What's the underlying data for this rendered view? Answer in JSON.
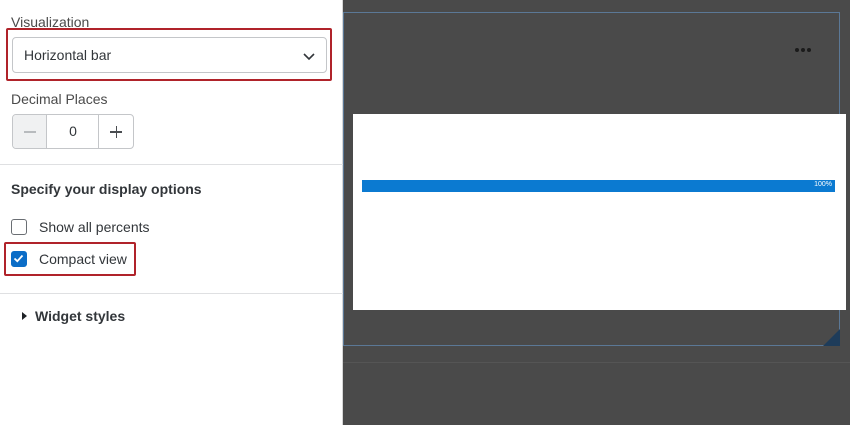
{
  "settings": {
    "visualization_label": "Visualization",
    "visualization_value": "Horizontal bar",
    "decimal_places_label": "Decimal Places",
    "decimal_places_value": "0",
    "display_options_title": "Specify your display options",
    "show_all_percents_label": "Show all percents",
    "show_all_percents_checked": false,
    "compact_view_label": "Compact view",
    "compact_view_checked": true,
    "widget_styles_label": "Widget styles"
  },
  "colors": {
    "highlight": "#b0232a",
    "bar": "#0b7ad1",
    "checkbox_checked": "#0b6dc7",
    "canvas_background": "#4a4a4a"
  },
  "icons": {
    "select": "chevron-down-icon",
    "stepper_decrement": "minus-icon",
    "stepper_increment": "plus-icon",
    "checkbox_checked": "checkmark-icon",
    "widget_styles": "caret-right-icon",
    "widget_menu": "more-options-icon",
    "resize": "resize-handle-icon"
  },
  "chart_data": {
    "type": "bar",
    "orientation": "horizontal",
    "values": [
      100
    ],
    "value_labels": [
      "100%"
    ]
  }
}
